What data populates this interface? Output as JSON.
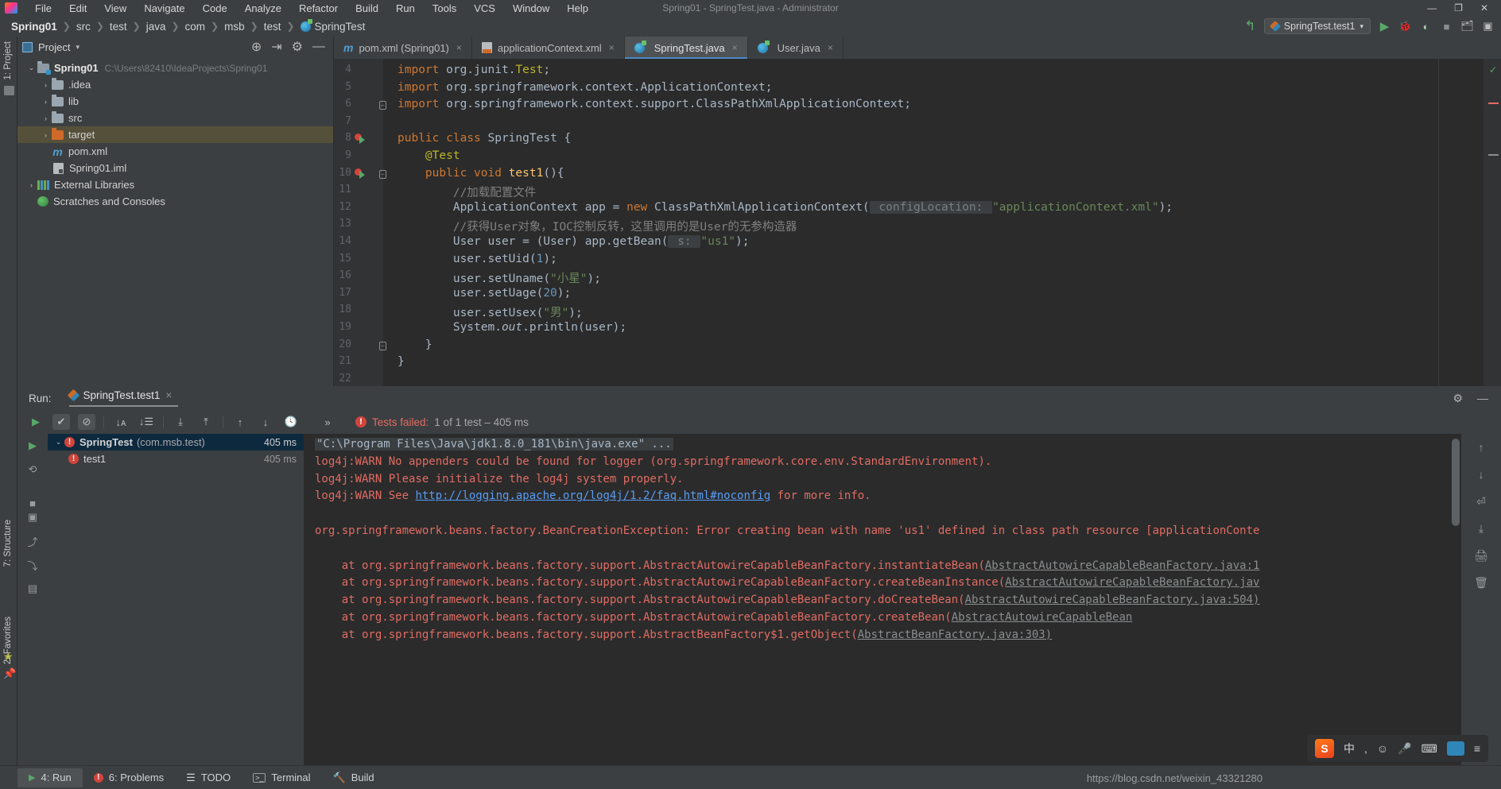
{
  "window": {
    "title": "Spring01 - SpringTest.java - Administrator",
    "menu": [
      "File",
      "Edit",
      "View",
      "Navigate",
      "Code",
      "Analyze",
      "Refactor",
      "Build",
      "Run",
      "Tools",
      "VCS",
      "Window",
      "Help"
    ],
    "controls": [
      "minimize-icon",
      "restore-icon",
      "close-icon"
    ]
  },
  "breadcrumb": {
    "project": "Spring01",
    "items": [
      "src",
      "test",
      "java",
      "com",
      "msb",
      "test"
    ],
    "class": "SpringTest"
  },
  "toolbar": {
    "back_icon": "back-arrow-icon",
    "run_config": "SpringTest.test1",
    "run_icon": "run-icon",
    "debug_icon": "debug-icon",
    "coverage_icon": "run-with-coverage-icon",
    "stop_icon": "stop-icon",
    "build_icon": "build-project-icon",
    "open_icon": "open-icon"
  },
  "left_strip": {
    "project_label": "1: Project",
    "structure_label": "7: Structure",
    "favorites_label": "2: Favorites"
  },
  "project_panel": {
    "title": "Project",
    "caret": "▾",
    "actions": [
      "locate-icon",
      "collapse-all-icon",
      "settings-icon",
      "hide-icon"
    ],
    "tree": [
      {
        "arrow": "⌄",
        "icon": "module-folder-icon",
        "name": "Spring01",
        "bold": true,
        "path": "C:\\Users\\82410\\IdeaProjects\\Spring01",
        "indent": 0,
        "selected": false
      },
      {
        "arrow": "›",
        "icon": "folder-icon",
        "name": ".idea",
        "indent": 1,
        "selected": false
      },
      {
        "arrow": "›",
        "icon": "folder-icon",
        "name": "lib",
        "indent": 1,
        "selected": false
      },
      {
        "arrow": "›",
        "icon": "folder-icon",
        "name": "src",
        "indent": 1,
        "selected": false
      },
      {
        "arrow": "›",
        "icon": "folder-excluded-icon",
        "name": "target",
        "indent": 1,
        "selected": true
      },
      {
        "arrow": "",
        "icon": "maven-file-icon",
        "name": "pom.xml",
        "indent": 1,
        "selected": false
      },
      {
        "arrow": "",
        "icon": "iml-file-icon",
        "name": "Spring01.iml",
        "indent": 1,
        "selected": false
      },
      {
        "arrow": "›",
        "icon": "libraries-icon",
        "name": "External Libraries",
        "indent": 0,
        "selected": false
      },
      {
        "arrow": "",
        "icon": "scratches-icon",
        "name": "Scratches and Consoles",
        "indent": 0,
        "selected": false
      }
    ]
  },
  "editor_tabs": [
    {
      "icon": "maven-file-icon",
      "label": "pom.xml (Spring01)",
      "active": false,
      "close": "×"
    },
    {
      "icon": "xml-file-icon",
      "label": "applicationContext.xml",
      "active": false,
      "close": "×"
    },
    {
      "icon": "java-class-icon",
      "label": "SpringTest.java",
      "active": true,
      "close": "×"
    },
    {
      "icon": "java-class-icon",
      "label": "User.java",
      "active": false,
      "close": "×"
    }
  ],
  "code": {
    "first_line_number": 4,
    "lines": [
      {
        "n": 4,
        "html": "<span class=\"kw\">import</span> org.junit.<span class=\"anno\">Test</span>;"
      },
      {
        "n": 5,
        "html": "<span class=\"kw\">import</span> org.springframework.context.ApplicationContext;"
      },
      {
        "n": 6,
        "html": "<span class=\"kw\">import</span> org.springframework.context.support.ClassPathXmlApplicationContext;"
      },
      {
        "n": 7,
        "html": ""
      },
      {
        "n": 8,
        "html": "<span class=\"kw\">public class</span> SpringTest {"
      },
      {
        "n": 9,
        "html": "    <span class=\"anno\">@Test</span>"
      },
      {
        "n": 10,
        "html": "    <span class=\"kw\">public void</span> <span class=\"fld-ann\">test1</span>(){"
      },
      {
        "n": 11,
        "html": "        <span class=\"cmt\">//加载配置文件</span>"
      },
      {
        "n": 12,
        "html": "        ApplicationContext app = <span class=\"kw\">new</span> ClassPathXmlApplicationContext(<span class=\"hint\"> configLocation: </span><span class=\"str\">\"applicationContext.xml\"</span>);"
      },
      {
        "n": 13,
        "html": "        <span class=\"cmt\">//获得User对象，IOC控制反转，这里调用的是User的无参构造器</span>"
      },
      {
        "n": 14,
        "html": "        User user = (User) app.getBean(<span class=\"hint\"> s: </span><span class=\"str\">\"us1\"</span>);"
      },
      {
        "n": 15,
        "html": "        user.setUid(<span class=\"num\">1</span>);"
      },
      {
        "n": 16,
        "html": "        user.setUname(<span class=\"str\">\"小星\"</span>);"
      },
      {
        "n": 17,
        "html": "        user.setUage(<span class=\"num\">20</span>);"
      },
      {
        "n": 18,
        "html": "        user.setUsex(<span class=\"str\">\"男\"</span>);"
      },
      {
        "n": 19,
        "html": "        System.<span style=\"font-style:italic\">out</span>.println(user);"
      },
      {
        "n": 20,
        "html": "    }"
      },
      {
        "n": 21,
        "html": "}"
      },
      {
        "n": 22,
        "html": ""
      }
    ],
    "run_markers": [
      8,
      10
    ],
    "inspection_status": "✓"
  },
  "run_panel": {
    "label": "Run:",
    "tab": "SpringTest.test1",
    "tab_close": "×",
    "settings_icon": "settings-icon",
    "hide_icon": "hide-icon",
    "toolbar": {
      "rerun_icon": "rerun-icon",
      "show_passed_icon": "show-passed-icon",
      "hide_ignored_icon": "hide-ignored-icon",
      "sort_alpha_icon": "sort-alphabetically-icon",
      "sort_duration_icon": "sort-by-duration-icon",
      "expand_all_icon": "expand-all-icon",
      "collapse_all_icon": "collapse-all-icon",
      "prev_icon": "previous-failed-icon",
      "next_icon": "next-failed-icon",
      "history_icon": "test-history-icon",
      "more_icon": "more-icon"
    },
    "status_prefix": "Tests failed:",
    "status_rest": "1 of 1 test – 405 ms",
    "left_buttons": [
      "rerun-icon",
      "rerun-failed-icon",
      "stop-icon",
      "camera-icon",
      "pin-icon",
      "export-icon",
      "layout-icon"
    ],
    "tests": [
      {
        "arrow": "⌄",
        "name": "SpringTest",
        "suffix": "(com.msb.test)",
        "time": "405 ms",
        "selected": true,
        "indent": 0
      },
      {
        "arrow": "",
        "name": "test1",
        "suffix": "",
        "time": "405 ms",
        "selected": false,
        "indent": 1
      }
    ]
  },
  "console": {
    "lines": [
      {
        "type": "cmd",
        "text": "\"C:\\Program Files\\Java\\jdk1.8.0_181\\bin\\java.exe\" ..."
      },
      {
        "type": "err",
        "text": "log4j:WARN No appenders could be found for logger (org.springframework.core.env.StandardEnvironment)."
      },
      {
        "type": "err",
        "text": "log4j:WARN Please initialize the log4j system properly."
      },
      {
        "type": "link",
        "pre": "log4j:WARN See ",
        "link": "http://logging.apache.org/log4j/1.2/faq.html#noconfig",
        "post": " for more info."
      },
      {
        "type": "blank",
        "text": ""
      },
      {
        "type": "err",
        "text": "org.springframework.beans.factory.BeanCreationException: Error creating bean with name 'us1' defined in class path resource [applicationConte"
      },
      {
        "type": "blank",
        "text": ""
      },
      {
        "type": "trace",
        "pre": "    at org.springframework.beans.factory.support.AbstractAutowireCapableBeanFactory.instantiateBean(",
        "link": "AbstractAutowireCapableBeanFactory.java:1"
      },
      {
        "type": "trace",
        "pre": "    at org.springframework.beans.factory.support.AbstractAutowireCapableBeanFactory.createBeanInstance(",
        "link": "AbstractAutowireCapableBeanFactory.jav"
      },
      {
        "type": "trace",
        "pre": "    at org.springframework.beans.factory.support.AbstractAutowireCapableBeanFactory.doCreateBean(",
        "link": "AbstractAutowireCapableBeanFactory.java:504)"
      },
      {
        "type": "trace",
        "pre": "    at org.springframework.beans.factory.support.AbstractAutowireCapableBeanFactory.createBean(",
        "link": "AbstractAutowireCapableBean"
      },
      {
        "type": "trace",
        "pre": "    at org.springframework.beans.factory.support.AbstractBeanFactory$1.getObject(",
        "link": "AbstractBeanFactory.java:303)"
      }
    ],
    "right_buttons": [
      "up-icon",
      "down-icon",
      "soft-wrap-icon",
      "scroll-to-end-icon",
      "print-icon",
      "clear-all-icon"
    ]
  },
  "status_bar": {
    "items": [
      {
        "icon": "run-icon",
        "label": "4: Run",
        "active": true
      },
      {
        "icon": "problems-icon",
        "label": "6: Problems",
        "active": false
      },
      {
        "icon": "todo-icon",
        "label": "TODO",
        "active": false
      },
      {
        "icon": "terminal-icon",
        "label": "Terminal",
        "active": false
      },
      {
        "icon": "build-icon",
        "label": "Build",
        "active": false
      }
    ],
    "watermark": "https://blog.csdn.net/weixin_43321280"
  },
  "ime": {
    "brand": "S",
    "lang": "中",
    "items": [
      "comma-icon",
      "smiley-icon",
      "mic-icon",
      "keyboard-icon",
      "tools-icon",
      "menu-icon"
    ]
  },
  "colors": {
    "accent_blue": "#4a88c7",
    "error_red": "#e06c63",
    "keyword_orange": "#cc7832",
    "string_green": "#6a8759",
    "selection_olive": "#55503a"
  }
}
